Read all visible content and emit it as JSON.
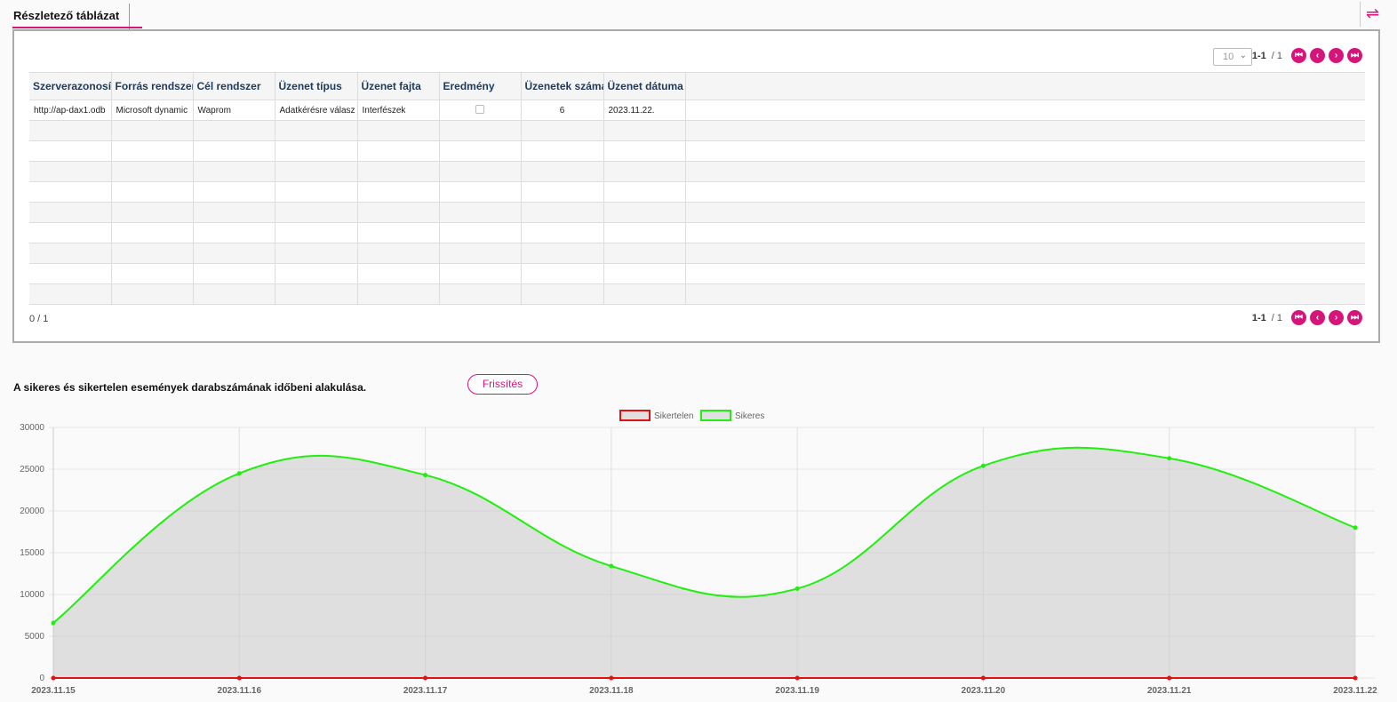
{
  "tab": {
    "title": "Részletező táblázat"
  },
  "swap_icon": "swap-arrows-icon",
  "pager": {
    "page_size": "10",
    "range": "1-1",
    "total": "/ 1",
    "buttons": {
      "first": "⏮",
      "prev": "‹",
      "next": "›",
      "last": "⏭"
    }
  },
  "table": {
    "columns": [
      "Szerverazonosító",
      "Forrás rendszer",
      "Cél rendszer",
      "Üzenet típus",
      "Üzenet fajta",
      "Eredmény",
      "Üzenetek száma",
      "Üzenet dátuma"
    ],
    "rows": [
      [
        "http://ap-dax1.odb",
        "Microsoft dynamic",
        "Waprom",
        "Adatkérésre válasz",
        "Interfészek",
        "",
        "6",
        "2023.11.22."
      ]
    ],
    "empty_rows": 9
  },
  "count": "0  /  1",
  "chart_section": {
    "title": "A sikeres és sikertelen események darabszámának időbeni alakulása.",
    "refresh_label": "Frissítés"
  },
  "colors": {
    "accent": "#d6157a",
    "success": "#22ee11",
    "fail": "#e11111"
  },
  "chart_data": {
    "type": "area",
    "categories": [
      "2023.11.15",
      "2023.11.16",
      "2023.11.17",
      "2023.11.18",
      "2023.11.19",
      "2023.11.20",
      "2023.11.21",
      "2023.11.22"
    ],
    "series": [
      {
        "name": "Sikertelen",
        "values": [
          0,
          0,
          0,
          0,
          0,
          0,
          0,
          0
        ]
      },
      {
        "name": "Sikeres",
        "values": [
          6600,
          24500,
          24300,
          13400,
          10700,
          25400,
          26300,
          18000
        ]
      }
    ],
    "ylim": [
      0,
      30000
    ],
    "yticks": [
      0,
      5000,
      10000,
      15000,
      20000,
      25000,
      30000
    ],
    "grid": true,
    "legend": "top-center"
  }
}
